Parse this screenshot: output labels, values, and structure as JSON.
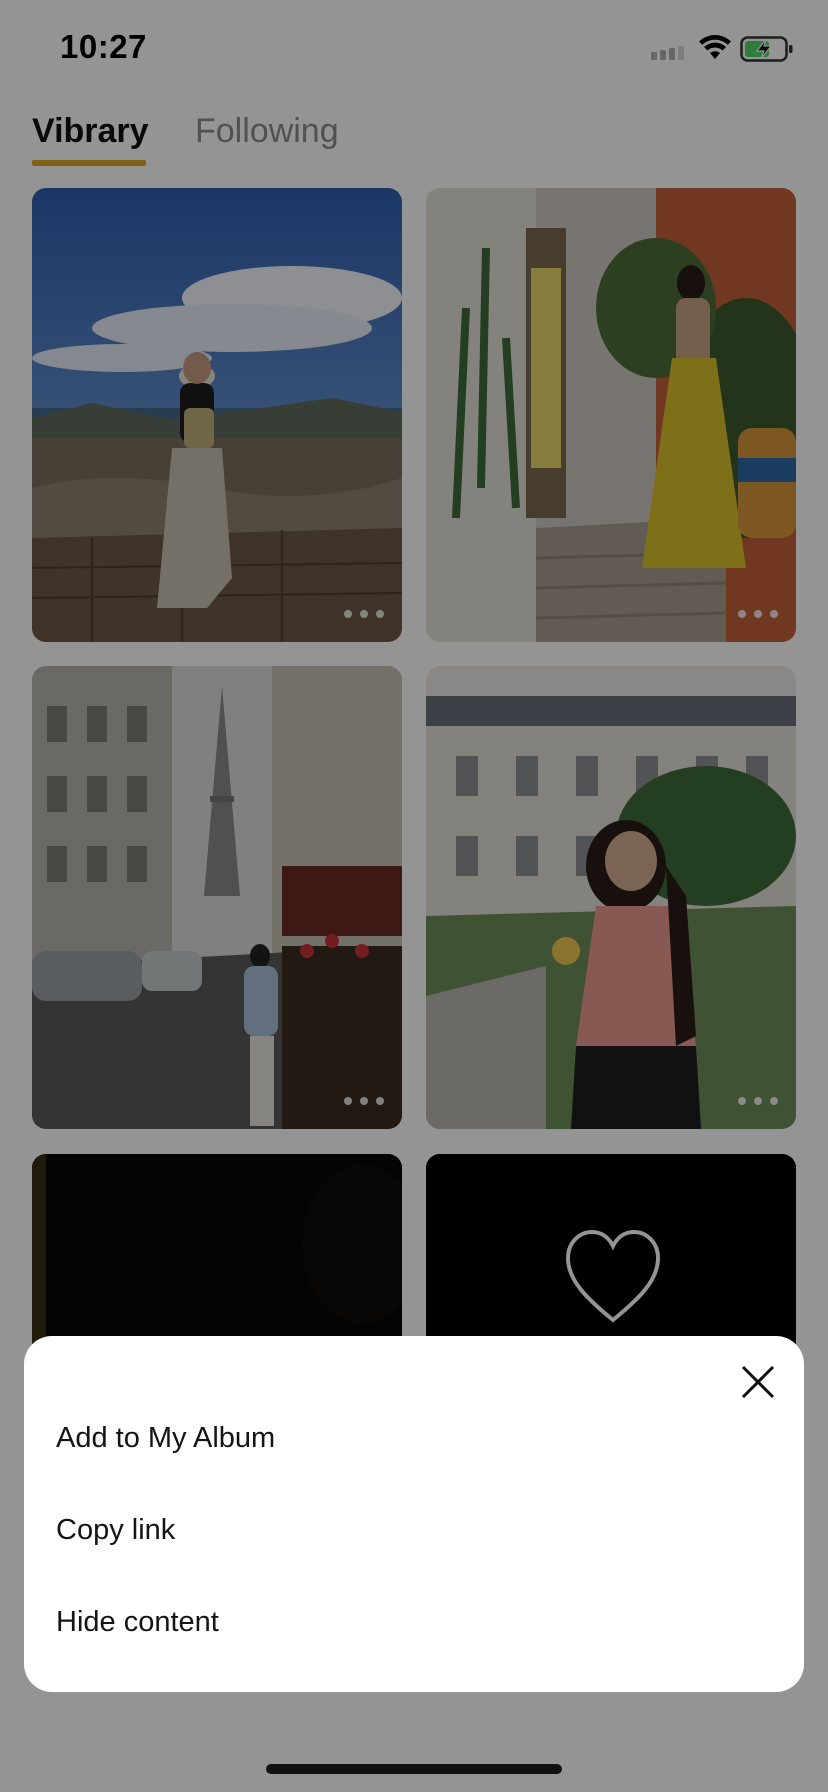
{
  "status_bar": {
    "time": "10:27"
  },
  "tabs": [
    {
      "label": "Vibrary",
      "active": true
    },
    {
      "label": "Following",
      "active": false
    }
  ],
  "colors": {
    "accent": "#e0a526",
    "overlay": "rgba(0,0,0,0.42)",
    "battery_fill": "#4cd964"
  },
  "feed": {
    "cards": [
      {
        "icon": "photo-ruins-woman",
        "has_carousel_dots": true
      },
      {
        "icon": "photo-yellow-dress-alley",
        "has_carousel_dots": true
      },
      {
        "icon": "photo-eiffel-street",
        "has_carousel_dots": true
      },
      {
        "icon": "photo-garden-pink-shirt",
        "has_carousel_dots": true
      },
      {
        "icon": "photo-dark",
        "has_carousel_dots": false
      },
      {
        "icon": "heart-icon",
        "has_carousel_dots": false
      }
    ]
  },
  "sheet": {
    "close_icon": "close-icon",
    "items": [
      {
        "label": "Add to My Album"
      },
      {
        "label": "Copy link"
      },
      {
        "label": "Hide content"
      }
    ]
  }
}
